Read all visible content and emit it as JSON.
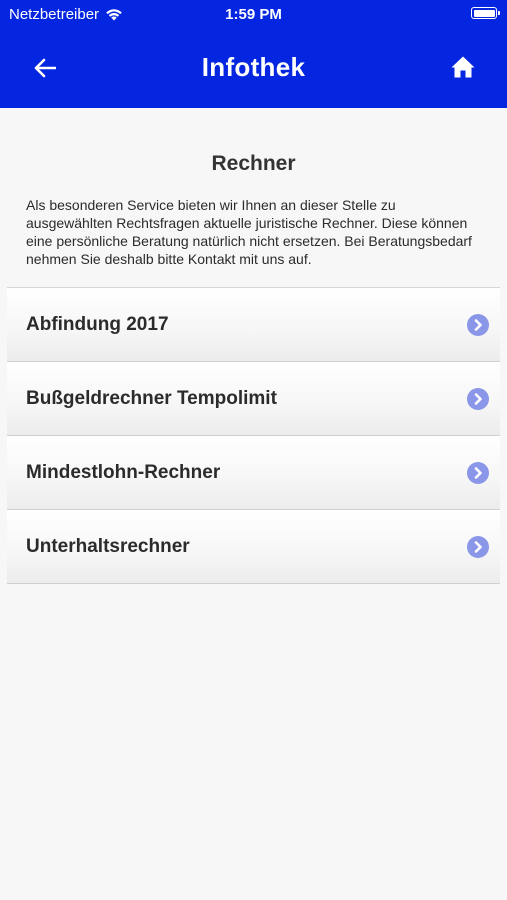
{
  "status_bar": {
    "carrier": "Netzbetreiber",
    "time": "1:59 PM"
  },
  "nav": {
    "title": "Infothek",
    "back_icon": "back-arrow-icon",
    "home_icon": "home-icon"
  },
  "page": {
    "title": "Rechner",
    "intro": "Als besonderen Service bieten wir Ihnen an dieser Stelle zu ausgewählten Rechtsfragen aktuelle juristische Rechner. Diese können eine persönliche Beratung natürlich nicht ersetzen. Bei Beratungsbedarf nehmen Sie deshalb bitte Kontakt mit uns auf."
  },
  "list": {
    "items": [
      {
        "label": "Abfindung 2017"
      },
      {
        "label": "Bußgeldrechner Tempolimit"
      },
      {
        "label": "Mindestlohn-Rechner"
      },
      {
        "label": "Unterhaltsrechner"
      }
    ]
  },
  "colors": {
    "header": "#0526e0",
    "background": "#f7f7f7",
    "chevron": "#8a96e8"
  }
}
